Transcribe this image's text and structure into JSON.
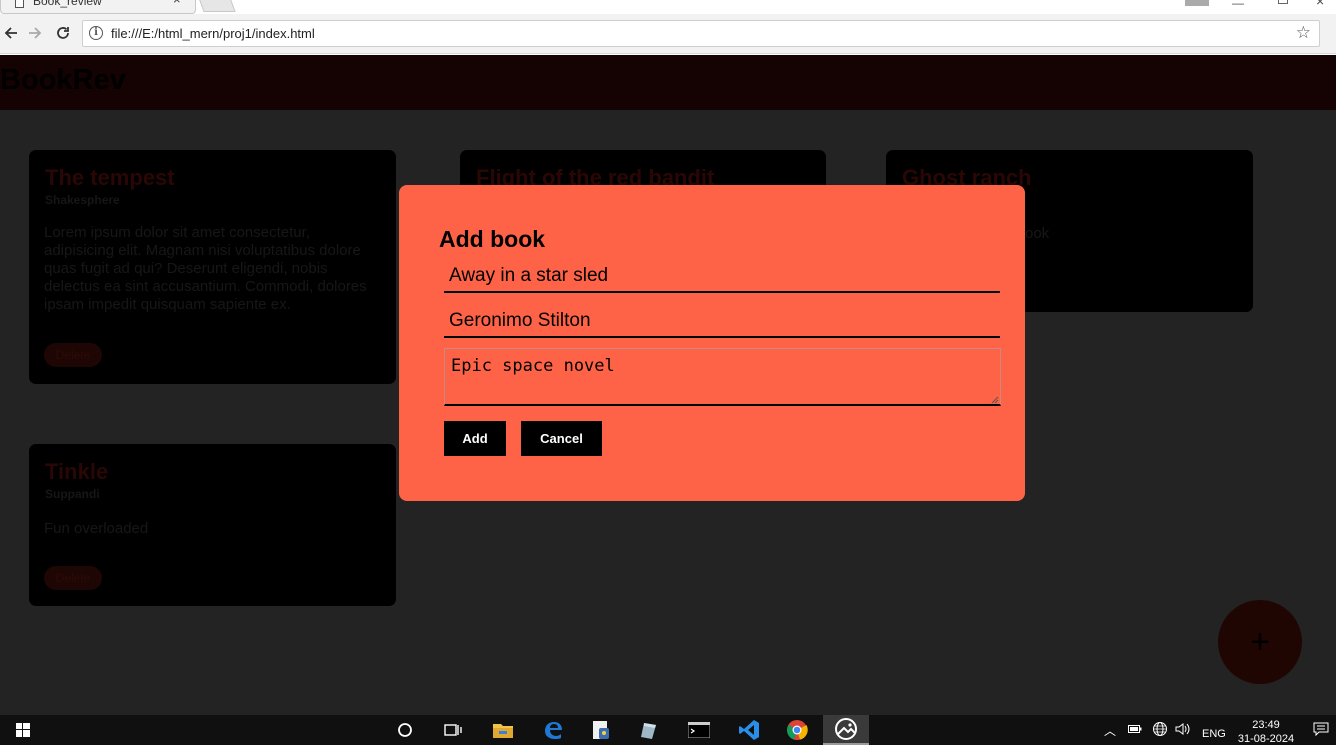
{
  "browser": {
    "tab_title": "Book_review",
    "tab_close": "×",
    "url": "file:///E:/html_mern/proj1/index.html"
  },
  "site": {
    "title": "BookRev",
    "add_fab_label": "+"
  },
  "books": [
    {
      "title": "The tempest",
      "author": "Shakesphere",
      "description": "Lorem ipsum dolor sit amet consectetur, adipisicing elit. Magnam nisi voluptatibus dolore quas fugit ad qui? Deserunt eligendi, nobis delectus ea sint accusantium. Commodi, dolores ipsam impedit quisquam sapiente ex.",
      "delete_label": "Delete"
    },
    {
      "title": "Flight of the red bandit"
    },
    {
      "title": "Ghost ranch",
      "description_visible": "ook"
    },
    {
      "title": "Tinkle",
      "author": "Suppandi",
      "description": "Fun overloaded",
      "delete_label": "Delete"
    }
  ],
  "modal": {
    "title": "Add book",
    "title_field_value": "Away in a star sled",
    "author_field_value": "Geronimo Stilton",
    "description_value": "Epic space novel",
    "add_label": "Add",
    "cancel_label": "Cancel"
  },
  "taskbar": {
    "language": "ENG",
    "time": "23:49",
    "date": "31-08-2024"
  },
  "colors": {
    "modal_bg": "#ff6347",
    "page_bg": "#232323",
    "card_bg": "#000000",
    "header_bg": "#150202"
  }
}
